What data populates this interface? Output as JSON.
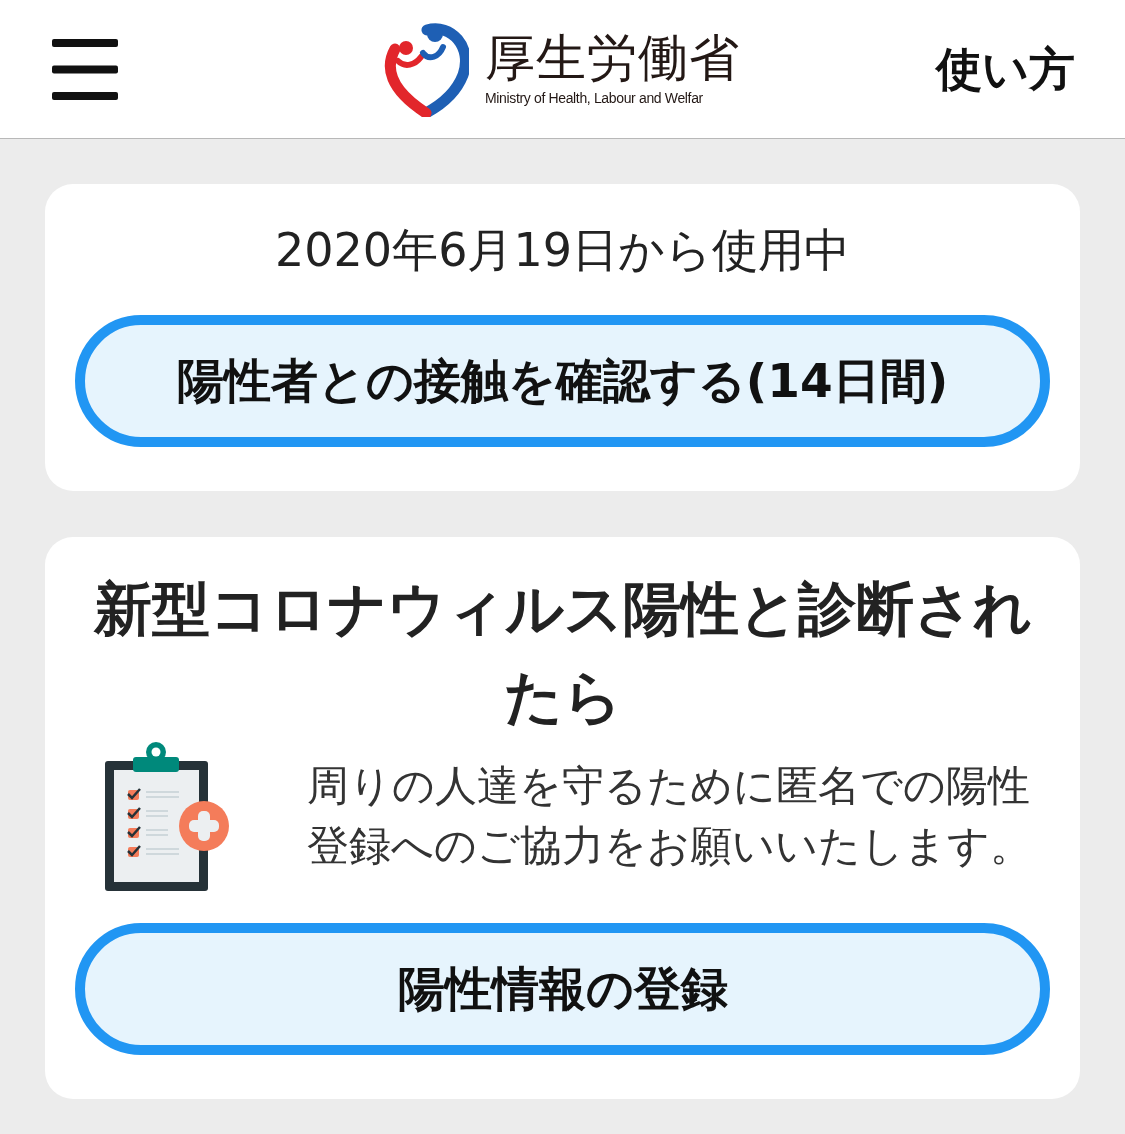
{
  "header": {
    "logo": {
      "title": "厚生労働省",
      "subtitle": "Ministry of Health, Labour and Welfar"
    },
    "help_link": "使い方"
  },
  "usage_card": {
    "since": "2020年6月19日から使用中",
    "button": "陽性者との接触を確認する(14日間)"
  },
  "positive_card": {
    "title": "新型コロナウィルス陽性と診断されたら",
    "message": "周りの人達を守るために匿名での陽性登録へのご協力をお願いいたします。",
    "button": "陽性情報の登録"
  }
}
